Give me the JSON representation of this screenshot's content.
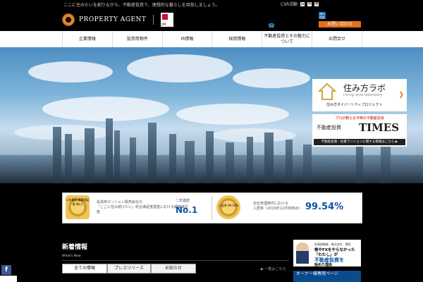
{
  "topbar": {
    "tagline": "ここに住みたいを創りながら、不動産投資で、理想的な暮らしを目指しましょう。",
    "csr": "CSR活動",
    "lang": [
      "Ja",
      "中",
      "英"
    ]
  },
  "header": {
    "company": "PROPERTY AGENT",
    "jpx_label": "JPX",
    "contact_button": "お問い合わせ",
    "badge": "無料相談"
  },
  "nav": {
    "items": [
      "企業情報",
      "投資用物件",
      "IR情報",
      "採用情報",
      "不動産投資とその魅力について",
      "お問合せ"
    ]
  },
  "promos": {
    "lab": {
      "title": "住み方ラボ",
      "subtitle": "Living style laboratory",
      "project": "住み方ダイバーシティプロジェクト"
    },
    "times": {
      "top": "プロが教える今時の不動産投資",
      "left": "不動産投資",
      "big": "TIMES",
      "bar": "不動産投資・投資マンションに関する情報はこちら ▶"
    }
  },
  "banner": {
    "medal1": "二年連続 顧客満足度 No.1",
    "text1": "投資用マンション販売会社の\n「ここに住み続けたい」総合満足度調査における顧客満足度",
    "no1_a": "二年連続",
    "no1_b": "No.1",
    "medal2": "入居率 99.54%",
    "text2": "自社管理物件における\n入居率（2019年12月末時点）",
    "rate": "99.54%"
  },
  "news": {
    "title": "新着情報",
    "subtitle": "What's New",
    "tabs": [
      "全ての情報",
      "プレスリリース",
      "お知らせ"
    ],
    "list_link": "▶ 一覧はこちら"
  },
  "side": {
    "ad_small": "投資経験者 · 株式会社 · 運用",
    "ad_line1": "株やFXをやらなかった",
    "ad_line2": "「わたし」が",
    "ad_line3": "不動産投資を",
    "ad_line4": "始めた理由",
    "button": "オーナー様専用ページ"
  },
  "social": {
    "fb": "f"
  },
  "colors": {
    "accent": "#e36f1e",
    "brand_blue": "#0a55a4",
    "nav_bg": "#ffffff"
  }
}
